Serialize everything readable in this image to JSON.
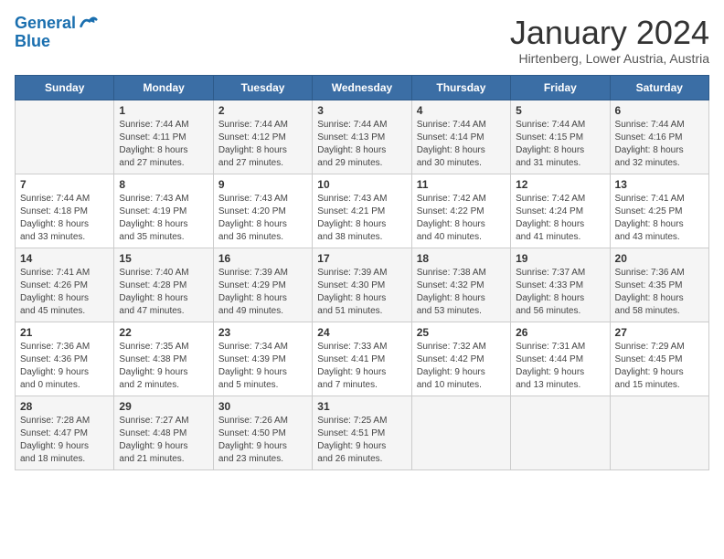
{
  "header": {
    "logo_line1": "General",
    "logo_line2": "Blue",
    "month": "January 2024",
    "location": "Hirtenberg, Lower Austria, Austria"
  },
  "days_of_week": [
    "Sunday",
    "Monday",
    "Tuesday",
    "Wednesday",
    "Thursday",
    "Friday",
    "Saturday"
  ],
  "weeks": [
    [
      {
        "day": "",
        "info": ""
      },
      {
        "day": "1",
        "info": "Sunrise: 7:44 AM\nSunset: 4:11 PM\nDaylight: 8 hours\nand 27 minutes."
      },
      {
        "day": "2",
        "info": "Sunrise: 7:44 AM\nSunset: 4:12 PM\nDaylight: 8 hours\nand 27 minutes."
      },
      {
        "day": "3",
        "info": "Sunrise: 7:44 AM\nSunset: 4:13 PM\nDaylight: 8 hours\nand 29 minutes."
      },
      {
        "day": "4",
        "info": "Sunrise: 7:44 AM\nSunset: 4:14 PM\nDaylight: 8 hours\nand 30 minutes."
      },
      {
        "day": "5",
        "info": "Sunrise: 7:44 AM\nSunset: 4:15 PM\nDaylight: 8 hours\nand 31 minutes."
      },
      {
        "day": "6",
        "info": "Sunrise: 7:44 AM\nSunset: 4:16 PM\nDaylight: 8 hours\nand 32 minutes."
      }
    ],
    [
      {
        "day": "7",
        "info": "Sunrise: 7:44 AM\nSunset: 4:18 PM\nDaylight: 8 hours\nand 33 minutes."
      },
      {
        "day": "8",
        "info": "Sunrise: 7:43 AM\nSunset: 4:19 PM\nDaylight: 8 hours\nand 35 minutes."
      },
      {
        "day": "9",
        "info": "Sunrise: 7:43 AM\nSunset: 4:20 PM\nDaylight: 8 hours\nand 36 minutes."
      },
      {
        "day": "10",
        "info": "Sunrise: 7:43 AM\nSunset: 4:21 PM\nDaylight: 8 hours\nand 38 minutes."
      },
      {
        "day": "11",
        "info": "Sunrise: 7:42 AM\nSunset: 4:22 PM\nDaylight: 8 hours\nand 40 minutes."
      },
      {
        "day": "12",
        "info": "Sunrise: 7:42 AM\nSunset: 4:24 PM\nDaylight: 8 hours\nand 41 minutes."
      },
      {
        "day": "13",
        "info": "Sunrise: 7:41 AM\nSunset: 4:25 PM\nDaylight: 8 hours\nand 43 minutes."
      }
    ],
    [
      {
        "day": "14",
        "info": "Sunrise: 7:41 AM\nSunset: 4:26 PM\nDaylight: 8 hours\nand 45 minutes."
      },
      {
        "day": "15",
        "info": "Sunrise: 7:40 AM\nSunset: 4:28 PM\nDaylight: 8 hours\nand 47 minutes."
      },
      {
        "day": "16",
        "info": "Sunrise: 7:39 AM\nSunset: 4:29 PM\nDaylight: 8 hours\nand 49 minutes."
      },
      {
        "day": "17",
        "info": "Sunrise: 7:39 AM\nSunset: 4:30 PM\nDaylight: 8 hours\nand 51 minutes."
      },
      {
        "day": "18",
        "info": "Sunrise: 7:38 AM\nSunset: 4:32 PM\nDaylight: 8 hours\nand 53 minutes."
      },
      {
        "day": "19",
        "info": "Sunrise: 7:37 AM\nSunset: 4:33 PM\nDaylight: 8 hours\nand 56 minutes."
      },
      {
        "day": "20",
        "info": "Sunrise: 7:36 AM\nSunset: 4:35 PM\nDaylight: 8 hours\nand 58 minutes."
      }
    ],
    [
      {
        "day": "21",
        "info": "Sunrise: 7:36 AM\nSunset: 4:36 PM\nDaylight: 9 hours\nand 0 minutes."
      },
      {
        "day": "22",
        "info": "Sunrise: 7:35 AM\nSunset: 4:38 PM\nDaylight: 9 hours\nand 2 minutes."
      },
      {
        "day": "23",
        "info": "Sunrise: 7:34 AM\nSunset: 4:39 PM\nDaylight: 9 hours\nand 5 minutes."
      },
      {
        "day": "24",
        "info": "Sunrise: 7:33 AM\nSunset: 4:41 PM\nDaylight: 9 hours\nand 7 minutes."
      },
      {
        "day": "25",
        "info": "Sunrise: 7:32 AM\nSunset: 4:42 PM\nDaylight: 9 hours\nand 10 minutes."
      },
      {
        "day": "26",
        "info": "Sunrise: 7:31 AM\nSunset: 4:44 PM\nDaylight: 9 hours\nand 13 minutes."
      },
      {
        "day": "27",
        "info": "Sunrise: 7:29 AM\nSunset: 4:45 PM\nDaylight: 9 hours\nand 15 minutes."
      }
    ],
    [
      {
        "day": "28",
        "info": "Sunrise: 7:28 AM\nSunset: 4:47 PM\nDaylight: 9 hours\nand 18 minutes."
      },
      {
        "day": "29",
        "info": "Sunrise: 7:27 AM\nSunset: 4:48 PM\nDaylight: 9 hours\nand 21 minutes."
      },
      {
        "day": "30",
        "info": "Sunrise: 7:26 AM\nSunset: 4:50 PM\nDaylight: 9 hours\nand 23 minutes."
      },
      {
        "day": "31",
        "info": "Sunrise: 7:25 AM\nSunset: 4:51 PM\nDaylight: 9 hours\nand 26 minutes."
      },
      {
        "day": "",
        "info": ""
      },
      {
        "day": "",
        "info": ""
      },
      {
        "day": "",
        "info": ""
      }
    ]
  ]
}
